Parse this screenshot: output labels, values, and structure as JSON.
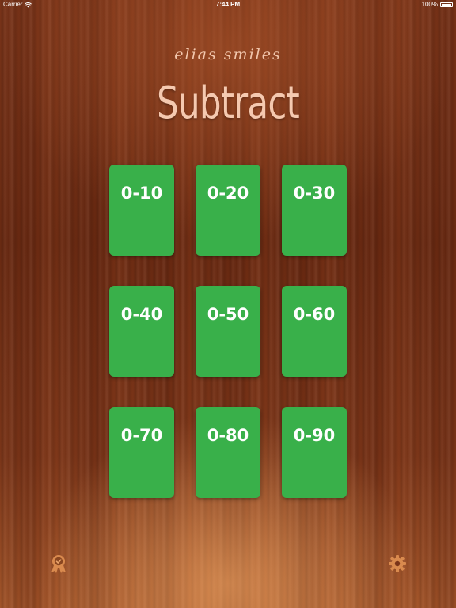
{
  "status_bar": {
    "carrier": "Carrier",
    "time": "7:44 PM",
    "battery": "100%",
    "battery_level": 1.0
  },
  "header": {
    "brand": "elias smiles",
    "title": "Subtract"
  },
  "cards": [
    {
      "label": "0-10"
    },
    {
      "label": "0-20"
    },
    {
      "label": "0-30"
    },
    {
      "label": "0-40"
    },
    {
      "label": "0-50"
    },
    {
      "label": "0-60"
    },
    {
      "label": "0-70"
    },
    {
      "label": "0-80"
    },
    {
      "label": "0-90"
    }
  ],
  "icons": {
    "left": "award-ribbon-icon",
    "right": "gear-icon"
  },
  "colors": {
    "card": "#39b04a",
    "title": "#f5c9b0",
    "icon": "#d98a4e"
  }
}
